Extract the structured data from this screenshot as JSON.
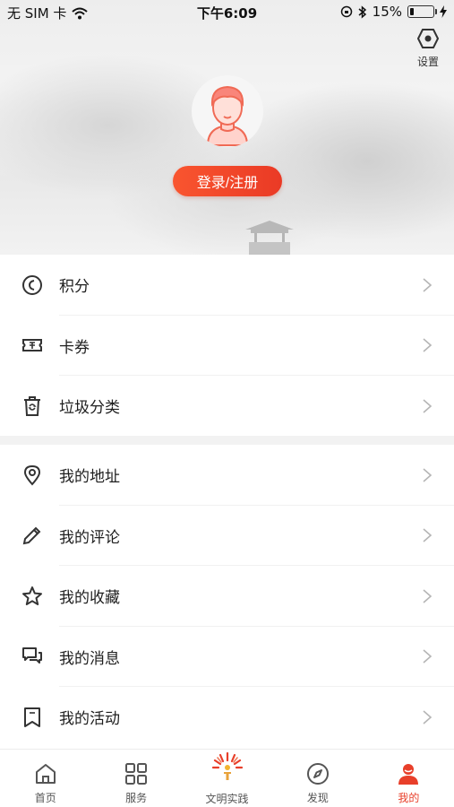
{
  "status_bar": {
    "carrier": "无 SIM 卡",
    "time": "下午6:09",
    "battery": "15%"
  },
  "header": {
    "settings_label": "设置",
    "login_button": "登录/注册"
  },
  "menu_group_1": [
    {
      "label": "积分",
      "icon": "coin-icon"
    },
    {
      "label": "卡券",
      "icon": "ticket-icon"
    },
    {
      "label": "垃圾分类",
      "icon": "trash-icon"
    }
  ],
  "menu_group_2": [
    {
      "label": "我的地址",
      "icon": "location-icon"
    },
    {
      "label": "我的评论",
      "icon": "pencil-icon"
    },
    {
      "label": "我的收藏",
      "icon": "star-icon"
    },
    {
      "label": "我的消息",
      "icon": "message-icon"
    },
    {
      "label": "我的活动",
      "icon": "bookmark-icon"
    }
  ],
  "tab_bar": [
    {
      "label": "首页",
      "icon": "home-icon",
      "active": false
    },
    {
      "label": "服务",
      "icon": "grid-icon",
      "active": false
    },
    {
      "label": "文明实践",
      "icon": "torch-icon",
      "active": false
    },
    {
      "label": "发现",
      "icon": "compass-icon",
      "active": false
    },
    {
      "label": "我的",
      "icon": "person-icon",
      "active": true
    }
  ],
  "colors": {
    "accent": "#e83f2a",
    "login_gradient_start": "#f9552f",
    "login_gradient_end": "#ea3a25",
    "icon_gray": "#555555"
  }
}
